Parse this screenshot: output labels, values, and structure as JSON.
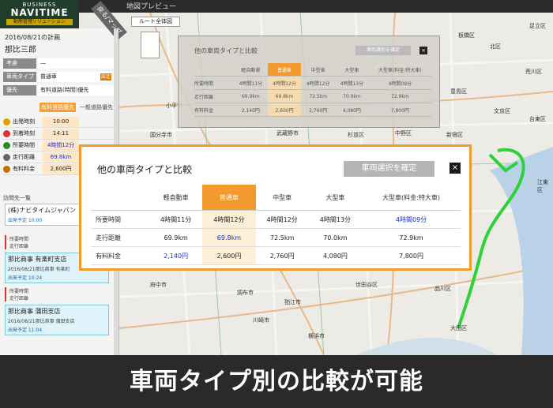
{
  "app": {
    "brand_line1": "BUSINESS",
    "brand_line2": "NAVITIME",
    "brand_line3": "動態管理ソリューション",
    "map_title": "地図プレビュー"
  },
  "sidebar": {
    "back_label": "戻る/マップ",
    "plan_date": "2016/08/21の計画",
    "plan_name": "那比三郎",
    "props": [
      {
        "key": "考慮",
        "value": "―"
      },
      {
        "key": "車両タイプ",
        "value": "普通車",
        "button": "設定"
      },
      {
        "key": "優先",
        "value": "有料道路(時間)優先"
      }
    ],
    "route_tabs": [
      "有料道路優先",
      "一般道路優先"
    ],
    "route_rows": [
      {
        "key": "出発時刻",
        "value": "10:00",
        "icon_color": "#e0a000"
      },
      {
        "key": "到着時刻",
        "value": "14:11",
        "icon_color": "#d33"
      },
      {
        "key": "所要時間",
        "value": "4時間12分",
        "icon_color": "#2a8a2a"
      },
      {
        "key": "走行距離",
        "value": "69.8km",
        "icon_color": "#666"
      },
      {
        "key": "有料料金",
        "value": "2,600円",
        "icon_color": "#c07000"
      }
    ],
    "visits_header": "訪問先一覧",
    "stops": [
      {
        "title": "(株)ナビタイムジャパン",
        "detail": "",
        "sched": "出発予定 10:00"
      },
      {
        "title": "那比商事 有楽町支店",
        "detail": "2016/08/21那比商事 有楽町",
        "sched": "出発予定 10:24"
      },
      {
        "title": "那比商事 蒲田支店",
        "detail": "2016/08/21那比商事 蒲田支店",
        "sched": "出発予定 11:04"
      }
    ],
    "legs": [
      {
        "line1": "所要時間",
        "line2": "走行距離"
      },
      {
        "line1": "所要時間",
        "line2": "走行距離"
      }
    ]
  },
  "map": {
    "route_all_label": "ルート全体図",
    "labels": [
      "板橋区",
      "足立区",
      "北区",
      "荒川区",
      "豊島区",
      "新宿区",
      "文京区",
      "台東区",
      "中野区",
      "杉並区",
      "小平市",
      "国分寺市",
      "武蔵野市",
      "府中市",
      "調布市",
      "狛江市",
      "世田谷区",
      "川崎市",
      "横浜市",
      "品川区",
      "大田区",
      "江東区"
    ]
  },
  "compare_bg": {
    "title": "他の車両タイプと比較",
    "confirm": "車両選択を確定",
    "close": "×",
    "headers": [
      "",
      "軽自動車",
      "普通車",
      "中型車",
      "大型車",
      "大型車(料金:特大車)"
    ],
    "rows": [
      {
        "label": "所要時間",
        "values": [
          "4時間11分",
          "4時間12分",
          "4時間12分",
          "4時間13分",
          "4時間09分"
        ]
      },
      {
        "label": "走行距離",
        "values": [
          "69.9km",
          "69.8km",
          "72.5km",
          "70.0km",
          "72.9km"
        ]
      },
      {
        "label": "有料料金",
        "values": [
          "2,140円",
          "2,600円",
          "2,760円",
          "4,080円",
          "7,800円"
        ]
      }
    ]
  },
  "compare": {
    "title": "他の車両タイプと比較",
    "confirm": "車両選択を確定",
    "close": "×",
    "headers": [
      "",
      "軽自動車",
      "普通車",
      "中型車",
      "大型車",
      "大型車(料金:特大車)"
    ],
    "selected_index": 1,
    "rows": [
      {
        "label": "所要時間",
        "values": [
          "4時間11分",
          "4時間12分",
          "4時間12分",
          "4時間13分",
          "4時間09分"
        ],
        "highlight": [
          4
        ]
      },
      {
        "label": "走行距離",
        "values": [
          "69.9km",
          "69.8km",
          "72.5km",
          "70.0km",
          "72.9km"
        ],
        "highlight": [
          1
        ]
      },
      {
        "label": "有料料金",
        "values": [
          "2,140円",
          "2,600円",
          "2,760円",
          "4,080円",
          "7,800円"
        ],
        "highlight": [
          0
        ]
      }
    ]
  },
  "caption": "車両タイプ別の比較が可能",
  "colors": {
    "accent": "#f29a2e",
    "route": "#2fd13a",
    "highlight_text": "#1a2fd0"
  }
}
